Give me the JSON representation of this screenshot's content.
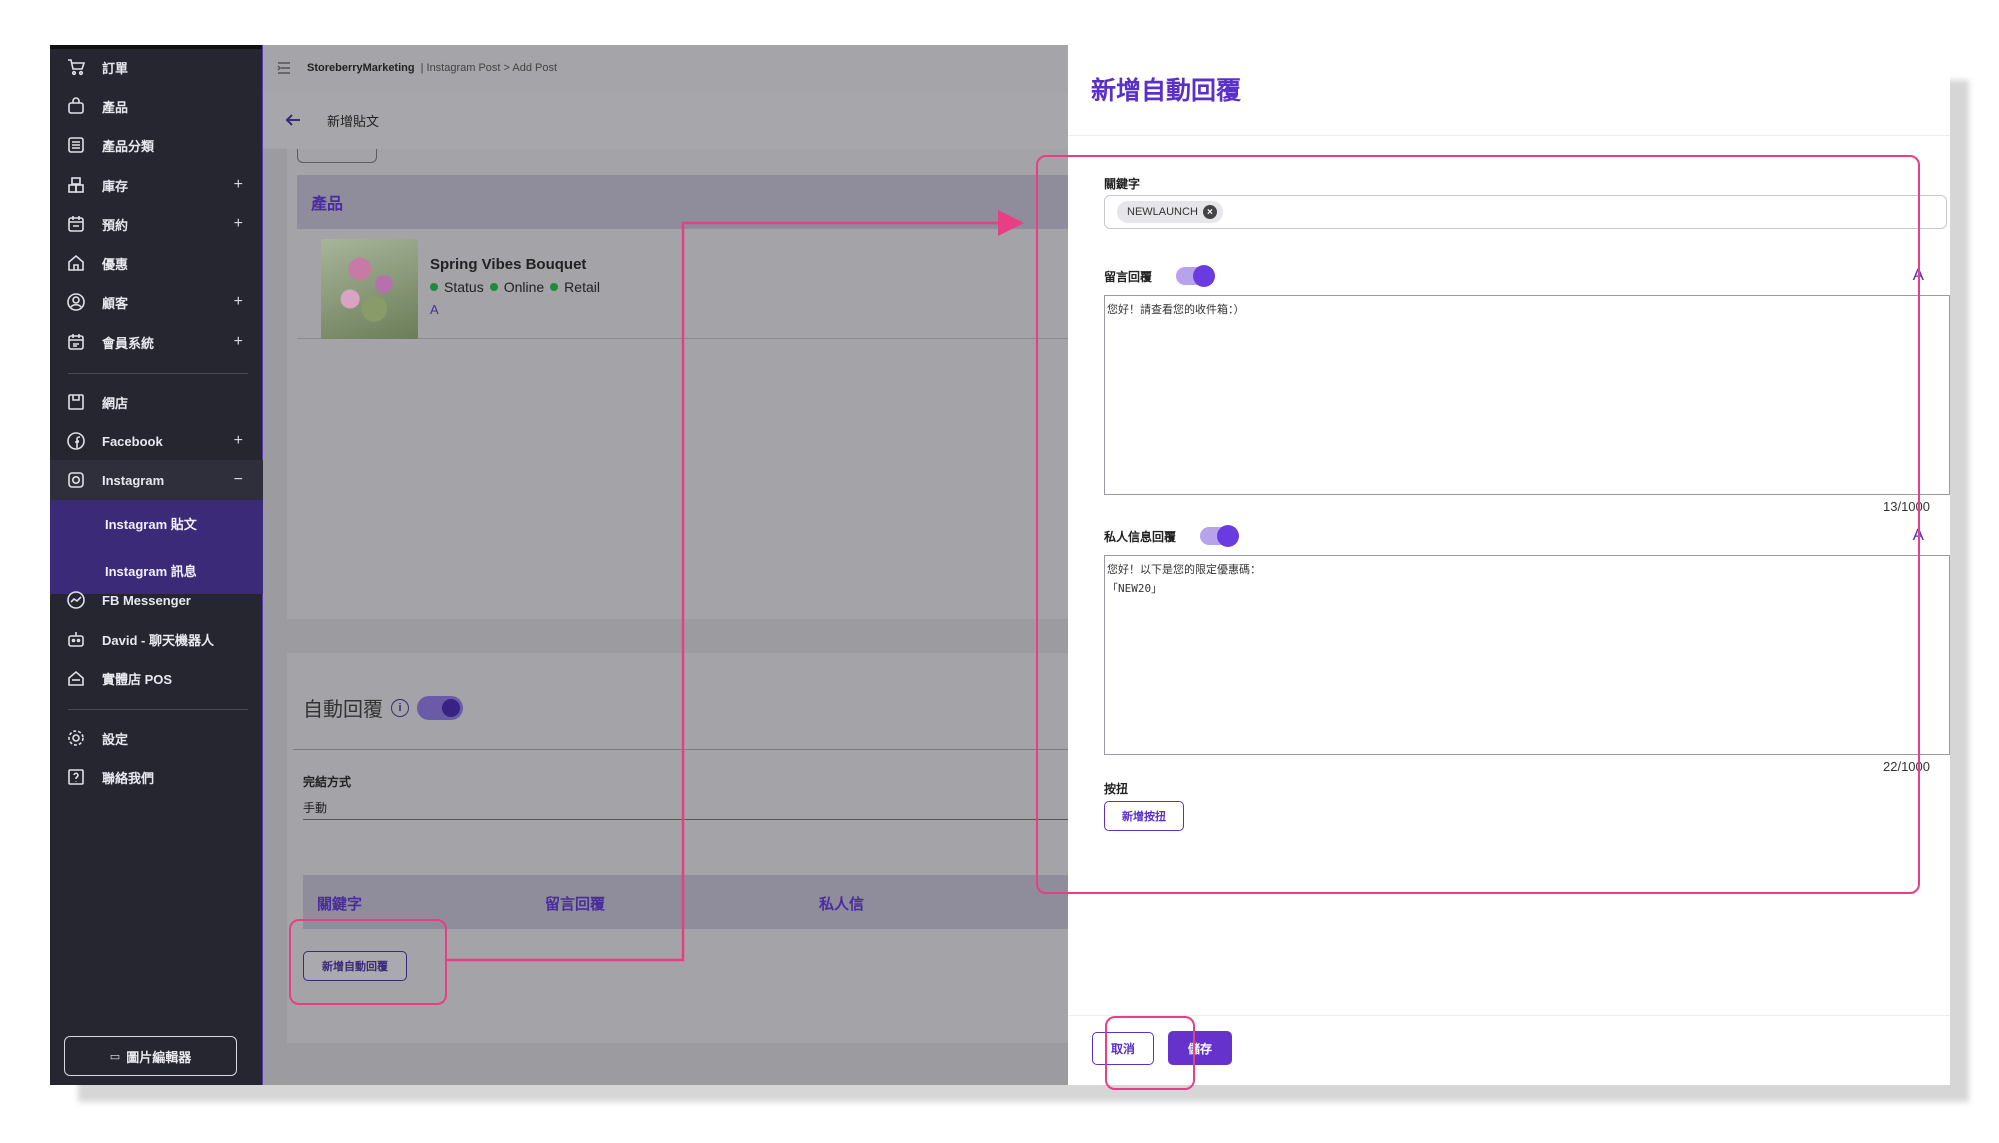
{
  "sidebar": {
    "items": [
      {
        "label": "訂單",
        "icon": "cart-icon",
        "plus": ""
      },
      {
        "label": "產品",
        "icon": "bag-icon",
        "plus": ""
      },
      {
        "label": "產品分類",
        "icon": "list-icon",
        "plus": ""
      },
      {
        "label": "庫存",
        "icon": "boxes-icon",
        "plus": "+"
      },
      {
        "label": "預約",
        "icon": "calendar-icon",
        "plus": "+"
      },
      {
        "label": "優惠",
        "icon": "store-icon",
        "plus": ""
      },
      {
        "label": "顧客",
        "icon": "user-circle-icon",
        "plus": "+"
      },
      {
        "label": "會員系統",
        "icon": "member-calendar-icon",
        "plus": "+"
      },
      {
        "label": "網店",
        "icon": "storefront-icon",
        "plus": ""
      },
      {
        "label": "Facebook",
        "icon": "facebook-icon",
        "plus": "+"
      },
      {
        "label": "Instagram",
        "icon": "instagram-icon",
        "plus": "−"
      },
      {
        "label": "FB Messenger",
        "icon": "messenger-icon",
        "plus": ""
      },
      {
        "label": "David - 聊天機器人",
        "icon": "robot-icon",
        "plus": ""
      },
      {
        "label": "實體店 POS",
        "icon": "pos-home-icon",
        "plus": ""
      },
      {
        "label": "設定",
        "icon": "gear-icon",
        "plus": ""
      },
      {
        "label": "聯絡我們",
        "icon": "help-icon",
        "plus": ""
      }
    ],
    "sub_items": [
      "Instagram 貼文",
      "Instagram 訊息"
    ],
    "image_editor": "圖片編輯器"
  },
  "topbar": {
    "breadcrumb_root": "StoreberryMarketing",
    "breadcrumb_rest": "| Instagram Post > Add Post"
  },
  "page": {
    "title": "新增貼文",
    "product_section": "產品",
    "product": {
      "name": "Spring Vibes Bouquet",
      "tags": [
        "Status",
        "Online",
        "Retail"
      ],
      "letter": "A"
    },
    "auto_reply": {
      "title": "自動回覆",
      "info": "i",
      "method_label": "完結方式",
      "method_value": "手動",
      "columns": [
        "關鍵字",
        "留言回覆",
        "私人信"
      ],
      "add_button": "新增自動回覆"
    }
  },
  "panel": {
    "title": "新增自動回覆",
    "keyword_label": "關鍵字",
    "keyword_chip": "NEWLAUNCH",
    "comment_reply_label": "留言回覆",
    "comment_reply_text": "您好！請查看您的收件箱：）",
    "comment_counter": "13/1000",
    "dm_reply_label": "私人信息回覆",
    "dm_reply_text": "您好！以下是您的限定優惠碼：\n「NEW20」",
    "dm_counter": "22/1000",
    "font_letter": "A",
    "buttons_label": "按扭",
    "add_button": "新增按扭",
    "cancel": "取消",
    "save": "儲存"
  },
  "colors": {
    "accent": "#5b30c8",
    "sidebar_bg": "#262630",
    "annotation": "#e83e84"
  }
}
